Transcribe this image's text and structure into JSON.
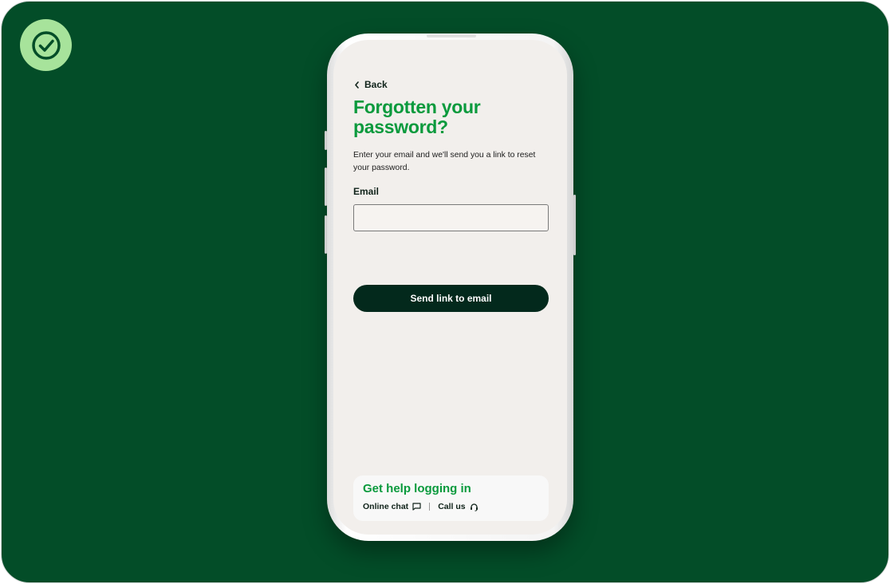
{
  "colors": {
    "background": "#034d28",
    "badge": "#a7e39b",
    "accent_green": "#0a9a3d",
    "button_dark": "#03291c",
    "screen": "#f2efec"
  },
  "badge": {
    "icon": "check-circle-icon"
  },
  "nav": {
    "back_label": "Back",
    "back_icon": "chevron-left-icon"
  },
  "page": {
    "title": "Forgotten your password?",
    "description": "Enter your email and we'll send you a link to reset your password."
  },
  "form": {
    "email_label": "Email",
    "email_value": "",
    "email_placeholder": "",
    "submit_label": "Send link to email"
  },
  "help": {
    "title": "Get help logging in",
    "chat_label": "Online chat",
    "chat_icon": "chat-bubble-icon",
    "call_label": "Call us",
    "call_icon": "headset-icon"
  }
}
